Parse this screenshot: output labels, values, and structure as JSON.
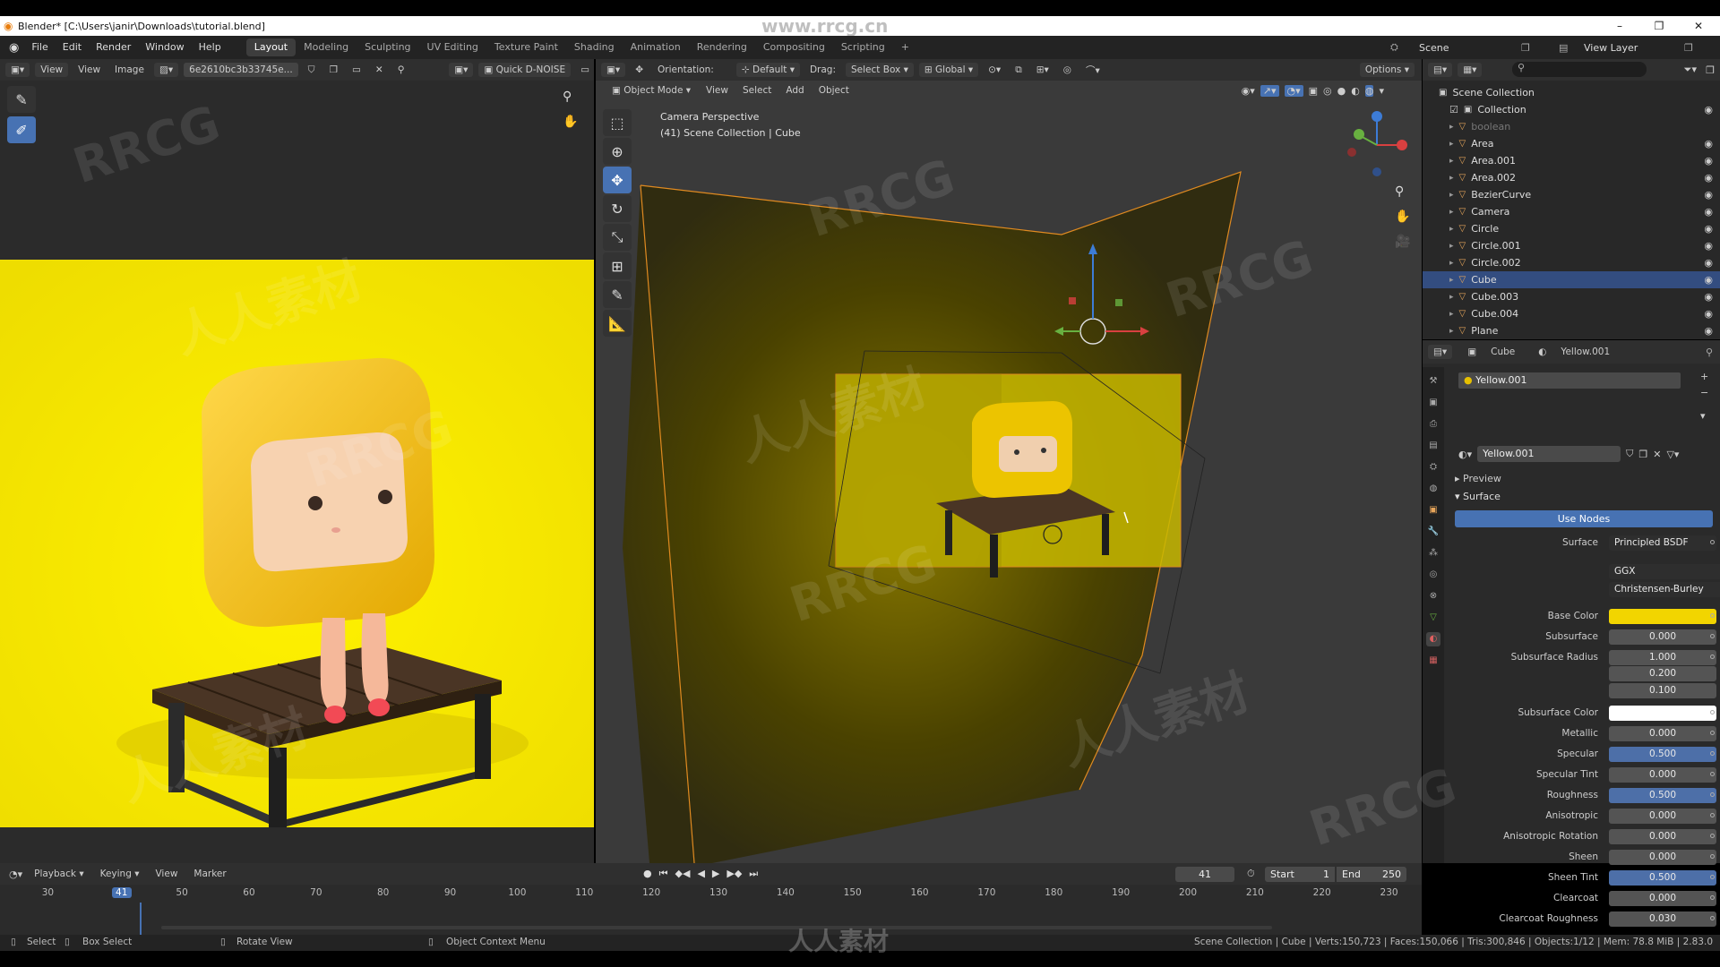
{
  "titlebar": {
    "title": "Blender* [C:\\Users\\janir\\Downloads\\tutorial.blend]",
    "watermark_url": "www.rrcg.cn",
    "minimize": "–",
    "maximize": "❐",
    "close": "✕"
  },
  "menu": {
    "items": [
      "File",
      "Edit",
      "Render",
      "Window",
      "Help"
    ]
  },
  "workspaces": [
    "Layout",
    "Modeling",
    "Sculpting",
    "UV Editing",
    "Texture Paint",
    "Shading",
    "Animation",
    "Rendering",
    "Compositing",
    "Scripting"
  ],
  "workspace_add": "+",
  "scene": {
    "label": "Scene",
    "view_layer": "View Layer"
  },
  "image_editor": {
    "menus": [
      "View",
      "View",
      "Image"
    ],
    "image_name": "6e2610bc3b33745e...",
    "denoise_label": "Quick D-NOISE"
  },
  "viewport": {
    "header": {
      "orientation_label": "Orientation:",
      "orientation_value": "Default",
      "drag_label": "Drag:",
      "drag_value": "Select Box",
      "transform_value": "Global",
      "options": "Options"
    },
    "mode_bar": {
      "mode": "Object Mode",
      "menus": [
        "View",
        "Select",
        "Add",
        "Object"
      ]
    },
    "overlay_title": "Camera Perspective",
    "overlay_subtitle": "(41) Scene Collection | Cube"
  },
  "outliner": {
    "root": "Scene Collection",
    "collection": "Collection",
    "items": [
      {
        "name": "boolean",
        "dim": true
      },
      {
        "name": "Area"
      },
      {
        "name": "Area.001"
      },
      {
        "name": "Area.002"
      },
      {
        "name": "BezierCurve"
      },
      {
        "name": "Camera"
      },
      {
        "name": "Circle"
      },
      {
        "name": "Circle.001"
      },
      {
        "name": "Circle.002"
      },
      {
        "name": "Cube",
        "selected": true
      },
      {
        "name": "Cube.003"
      },
      {
        "name": "Cube.004"
      },
      {
        "name": "Plane"
      }
    ]
  },
  "properties": {
    "breadcrumb_object": "Cube",
    "breadcrumb_material": "Yellow.001",
    "slot_name": "Yellow.001",
    "material_name": "Yellow.001",
    "panel_preview": "Preview",
    "panel_surface": "Surface",
    "use_nodes": "Use Nodes",
    "surface_label": "Surface",
    "surface_value": "Principled BSDF",
    "distribution": "GGX",
    "subsurface_method": "Christensen-Burley",
    "rows": [
      {
        "label": "Base Color",
        "value": "",
        "type": "color",
        "color": "#f2d500"
      },
      {
        "label": "Subsurface",
        "value": "0.000"
      },
      {
        "label": "Subsurface Radius",
        "value": "1.000",
        "value2": "0.200",
        "value3": "0.100"
      },
      {
        "label": "Subsurface Color",
        "value": "",
        "type": "color",
        "color": "#ffffff"
      },
      {
        "label": "Metallic",
        "value": "0.000"
      },
      {
        "label": "Specular",
        "value": "0.500",
        "blue": true
      },
      {
        "label": "Specular Tint",
        "value": "0.000"
      },
      {
        "label": "Roughness",
        "value": "0.500",
        "blue": true
      },
      {
        "label": "Anisotropic",
        "value": "0.000"
      },
      {
        "label": "Anisotropic Rotation",
        "value": "0.000"
      },
      {
        "label": "Sheen",
        "value": "0.000"
      },
      {
        "label": "Sheen Tint",
        "value": "0.500",
        "blue": true
      },
      {
        "label": "Clearcoat",
        "value": "0.000"
      },
      {
        "label": "Clearcoat Roughness",
        "value": "0.030"
      }
    ]
  },
  "timeline": {
    "menus": [
      "Playback",
      "Keying",
      "View",
      "Marker"
    ],
    "current_frame": "41",
    "start_label": "Start",
    "start": "1",
    "end_label": "End",
    "end": "250",
    "ticks": [
      "30",
      "41",
      "50",
      "60",
      "70",
      "80",
      "90",
      "100",
      "110",
      "120",
      "130",
      "140",
      "150",
      "160",
      "170",
      "180",
      "190",
      "200",
      "210",
      "220",
      "230"
    ]
  },
  "statusbar": {
    "select": "Select",
    "box_select": "Box Select",
    "rotate_view": "Rotate View",
    "context_menu": "Object Context Menu",
    "stats": "Scene Collection | Cube | Verts:150,723 | Faces:150,066 | Tris:300,846 | Objects:1/12 | Mem: 78.8 MiB | 2.83.0"
  },
  "watermarks": {
    "rrcg": "RRCG",
    "cn": "人人素材"
  },
  "colors": {
    "accent": "#4772b3",
    "selection": "#334d80",
    "render_bg": "#f4e500",
    "object_orange": "#e6a55a"
  }
}
